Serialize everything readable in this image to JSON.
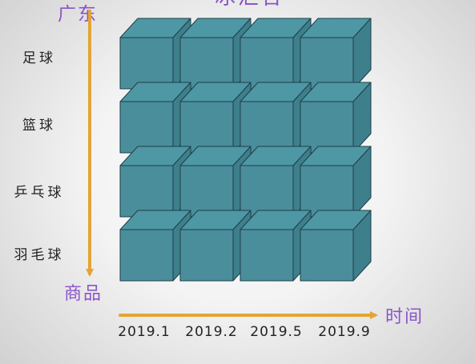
{
  "title_fragment": "冰汇合",
  "region": "广东",
  "axes": {
    "vertical_name": "商品",
    "horizontal_name": "时间"
  },
  "rows": [
    "足球",
    "篮球",
    "乒乓球",
    "羽毛球"
  ],
  "columns": [
    "2019.1",
    "2019.2",
    "2019.5",
    "2019.9"
  ],
  "colors": {
    "cube_front": "#4a8e9c",
    "cube_top": "#4e97a5",
    "cube_side": "#3e7f8c",
    "cube_edge": "#1f3f47",
    "axis_arrow": "#e2a535",
    "label_purple": "#8a55c9"
  }
}
